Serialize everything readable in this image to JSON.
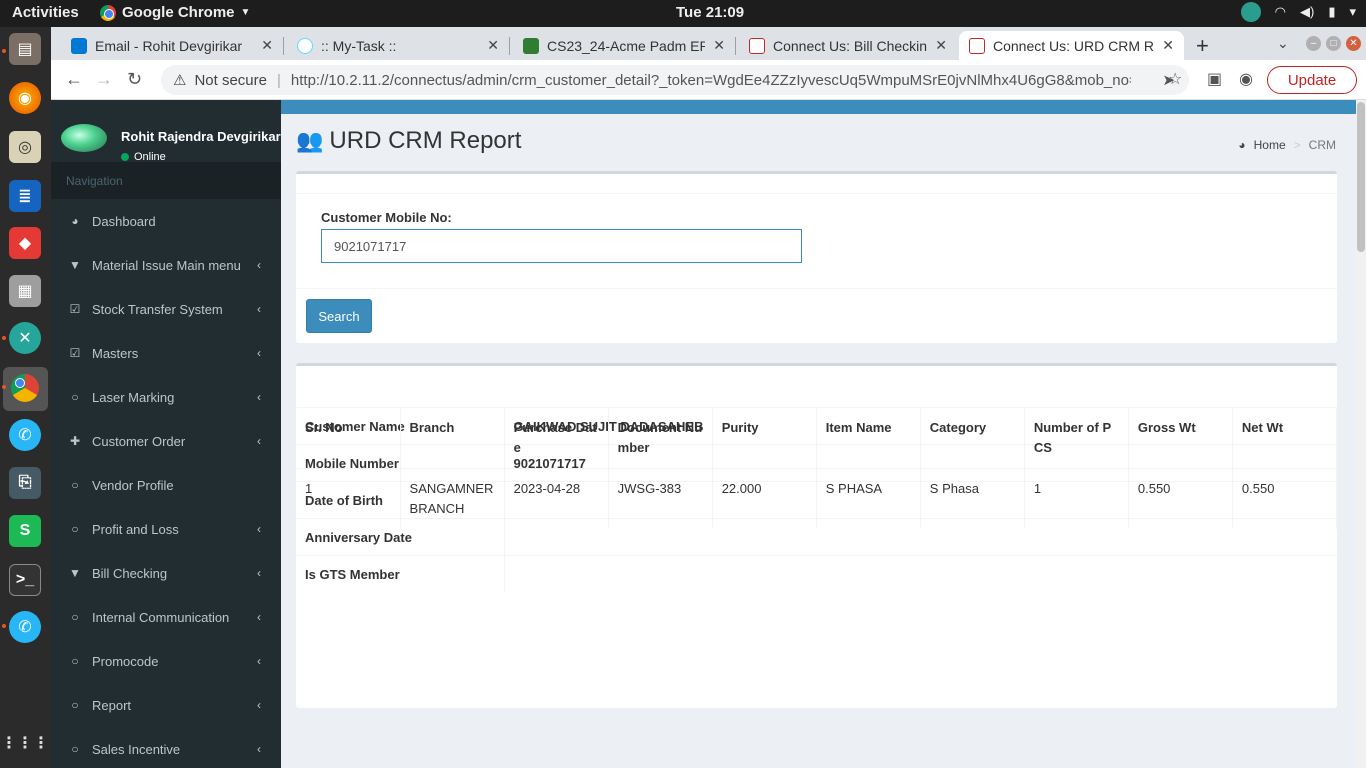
{
  "os": {
    "activities": "Activities",
    "app_name": "Google Chrome",
    "clock": "Tue 21:09"
  },
  "browser": {
    "tabs": [
      {
        "label": "Email - Rohit Devgirikar",
        "color": "#0078d4",
        "active": false
      },
      {
        "label": ":: My-Task ::",
        "color": "#61dafb",
        "active": false
      },
      {
        "label": "CS23_24-Acme Padm ER",
        "color": "#2e7d32",
        "active": false
      },
      {
        "label": "Connect Us: Bill Checkin",
        "color": "#c62828",
        "active": false
      },
      {
        "label": "Connect Us: URD CRM R",
        "color": "#c62828",
        "active": true
      }
    ],
    "security_label": "Not secure",
    "url": "http://10.2.11.2/connectus/admin/crm_customer_detail?_token=WgdEe4ZZzIyvescUq5WmpuMSrE0jvNlMhx4U6gG8&mob_no=902...",
    "update_label": "Update"
  },
  "sidebar": {
    "user_name": "Rohit Rajendra Devgirikar",
    "user_status": "Online",
    "nav_header": "Navigation",
    "items": [
      {
        "label": "Dashboard",
        "icon": "dashboard-icon",
        "glyph": "◕",
        "submenu": false
      },
      {
        "label": "Material Issue Main menu",
        "icon": "filter-icon",
        "glyph": "▼",
        "submenu": true
      },
      {
        "label": "Stock Transfer System",
        "icon": "check-square-icon",
        "glyph": "☑",
        "submenu": true
      },
      {
        "label": "Masters",
        "icon": "check-square-icon",
        "glyph": "☑",
        "submenu": true
      },
      {
        "label": "Laser Marking",
        "icon": "circle-icon",
        "glyph": "○",
        "submenu": true
      },
      {
        "label": "Customer Order",
        "icon": "plus-icon",
        "glyph": "✚",
        "submenu": true
      },
      {
        "label": "Vendor Profile",
        "icon": "circle-icon",
        "glyph": "○",
        "submenu": false
      },
      {
        "label": "Profit and Loss",
        "icon": "circle-icon",
        "glyph": "○",
        "submenu": true
      },
      {
        "label": "Bill Checking",
        "icon": "filter-icon",
        "glyph": "▼",
        "submenu": true
      },
      {
        "label": "Internal Communication",
        "icon": "circle-icon",
        "glyph": "○",
        "submenu": true
      },
      {
        "label": "Promocode",
        "icon": "circle-icon",
        "glyph": "○",
        "submenu": true
      },
      {
        "label": "Report",
        "icon": "circle-icon",
        "glyph": "○",
        "submenu": true
      },
      {
        "label": "Sales Incentive",
        "icon": "circle-icon",
        "glyph": "○",
        "submenu": true
      }
    ]
  },
  "page": {
    "title": "URD CRM Report",
    "breadcrumb_home": "Home",
    "breadcrumb_current": "CRM",
    "mobile_label": "Customer Mobile No:",
    "mobile_value": "9021071717",
    "search_label": "Search"
  },
  "customer": [
    {
      "key": "Customer Name",
      "value": "GAIKWAD SUJIT DADASAHEB"
    },
    {
      "key": "Mobile Number",
      "value": "9021071717"
    },
    {
      "key": "Date of Birth",
      "value": ""
    },
    {
      "key": "Anniversary Date",
      "value": ""
    },
    {
      "key": "Is GTS Member",
      "value": ""
    }
  ],
  "purchases": {
    "columns": [
      "Sr. No",
      "Branch",
      "Purchase Date",
      "Document Number",
      "Purity",
      "Item Name",
      "Category",
      "Number of PCS",
      "Gross Wt",
      "Net Wt"
    ],
    "rows": [
      [
        "1",
        "SANGAMNER BRANCH",
        "2023-04-28",
        "JWSG-383",
        "22.000",
        "S PHASA",
        "S Phasa",
        "1",
        "0.550",
        "0.550"
      ]
    ]
  }
}
